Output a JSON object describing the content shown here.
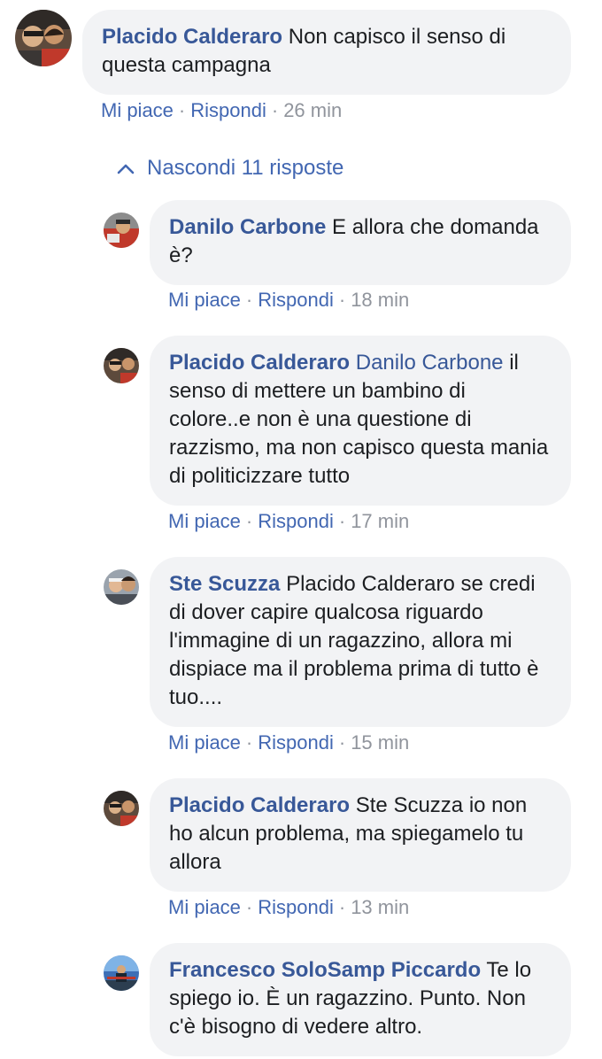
{
  "thread": {
    "main_comment": {
      "author": "Placido Calderaro",
      "text": "Non capisco il senso di questa campagna",
      "actions": {
        "like": "Mi piace",
        "reply": "Rispondi",
        "time": "26 min"
      }
    },
    "toggle_label": "Nascondi 11 risposte",
    "replies": [
      {
        "author": "Danilo Carbone",
        "mention": "",
        "text": "E allora che domanda è?",
        "actions": {
          "like": "Mi piace",
          "reply": "Rispondi",
          "time": "18 min"
        }
      },
      {
        "author": "Placido Calderaro",
        "mention": "Danilo Carbone",
        "text": "il senso di mettere un bambino di colore..e non è una questione di razzismo, ma non capisco questa mania di politicizzare tutto",
        "actions": {
          "like": "Mi piace",
          "reply": "Rispondi",
          "time": "17 min"
        }
      },
      {
        "author": "Ste Scuzza",
        "mention": "",
        "text": "Placido Calderaro se credi di dover capire qualcosa riguardo l'immagine di un ragazzino, allora mi dispiace ma il problema prima di tutto è tuo....",
        "actions": {
          "like": "Mi piace",
          "reply": "Rispondi",
          "time": "15 min"
        }
      },
      {
        "author": "Placido Calderaro",
        "mention": "",
        "text": "Ste Scuzza io non ho alcun problema, ma spiegamelo tu allora",
        "actions": {
          "like": "Mi piace",
          "reply": "Rispondi",
          "time": "13 min"
        }
      },
      {
        "author": "Francesco SoloSamp Piccardo",
        "mention": "",
        "text": "Te lo spiego io. È un ragazzino. Punto. Non c'è bisogno di vedere altro."
      }
    ]
  },
  "colors": {
    "link": "#385898",
    "action_link": "#4267b2",
    "bubble_bg": "#f2f3f5",
    "meta": "#90949c"
  },
  "icons": {
    "toggle": "chevron-up-icon"
  }
}
